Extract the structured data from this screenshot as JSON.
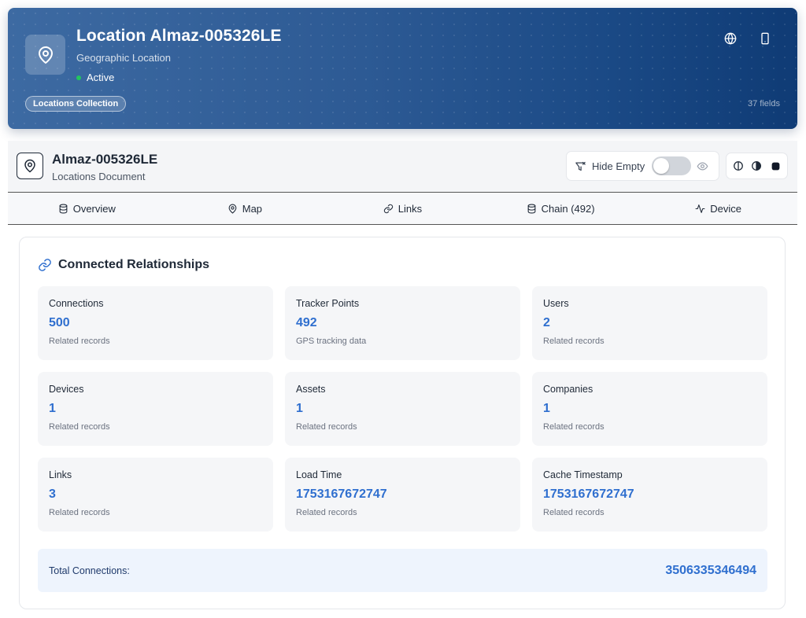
{
  "hero": {
    "title": "Location Almaz-005326LE",
    "subtitle": "Geographic Location",
    "status": "Active",
    "badge": "Locations Collection",
    "fields_count": "37 fields"
  },
  "doc_header": {
    "title": "Almaz-005326LE",
    "subtitle": "Locations Document",
    "hide_empty_label": "Hide Empty"
  },
  "tabs": [
    {
      "label": "Overview",
      "icon": "database-icon"
    },
    {
      "label": "Map",
      "icon": "map-pin-icon"
    },
    {
      "label": "Links",
      "icon": "link-icon"
    },
    {
      "label": "Chain (492)",
      "icon": "database-icon"
    },
    {
      "label": "Device",
      "icon": "activity-icon"
    }
  ],
  "relationships": {
    "title": "Connected Relationships",
    "stats": [
      {
        "label": "Connections",
        "value": "500",
        "desc": "Related records"
      },
      {
        "label": "Tracker Points",
        "value": "492",
        "desc": "GPS tracking data"
      },
      {
        "label": "Users",
        "value": "2",
        "desc": "Related records"
      },
      {
        "label": "Devices",
        "value": "1",
        "desc": "Related records"
      },
      {
        "label": "Assets",
        "value": "1",
        "desc": "Related records"
      },
      {
        "label": "Companies",
        "value": "1",
        "desc": "Related records"
      },
      {
        "label": "Links",
        "value": "3",
        "desc": "Related records"
      },
      {
        "label": "Load Time",
        "value": "1753167672747",
        "desc": "Related records"
      },
      {
        "label": "Cache Timestamp",
        "value": "1753167672747",
        "desc": "Related records"
      }
    ],
    "total_label": "Total Connections:",
    "total_value": "3506335346494"
  },
  "colors": {
    "accent": "#2f6fcf",
    "hero_start": "#3d6aa2",
    "hero_end": "#0f3b75",
    "status_active": "#22c55e"
  }
}
